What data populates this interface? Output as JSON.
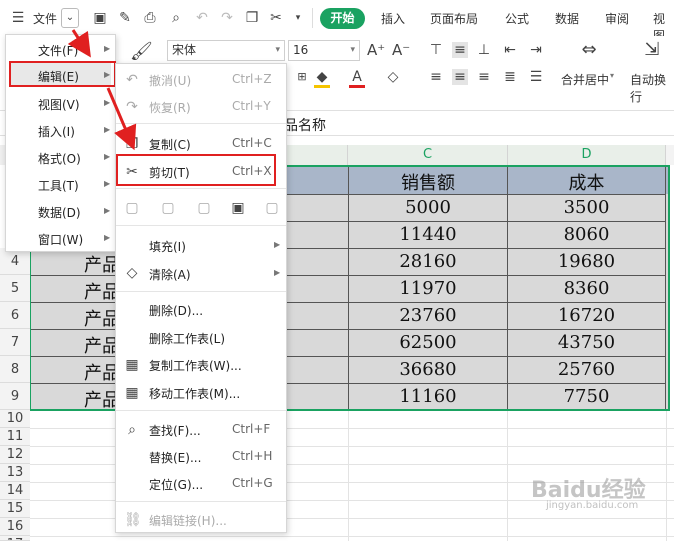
{
  "toolbar": {
    "menu_label": "文件",
    "tabs": [
      "开始",
      "插入",
      "页面布局",
      "公式",
      "数据",
      "审阅",
      "视图"
    ]
  },
  "ribbon": {
    "font_name": "宋体",
    "font_size": "16",
    "merge_label": "合并居中",
    "wrap_label": "自动换行"
  },
  "formula_bar": {
    "content": "品名称"
  },
  "columns": [
    "C",
    "D"
  ],
  "rows": [
    "4",
    "5",
    "6",
    "7",
    "8",
    "9",
    "10",
    "11",
    "12",
    "13",
    "14",
    "15",
    "16",
    "17",
    "18"
  ],
  "table": {
    "header": [
      "销售额",
      "成本"
    ],
    "partial_header": "t",
    "product_label": "产品",
    "sales": [
      "5000",
      "11440",
      "28160",
      "11970",
      "23760",
      "62500",
      "36680",
      "11160"
    ],
    "cost": [
      "3500",
      "8060",
      "19680",
      "8360",
      "16720",
      "43750",
      "25760",
      "7750"
    ]
  },
  "main_menu": {
    "items": [
      "文件(F)",
      "编辑(E)",
      "视图(V)",
      "插入(I)",
      "格式(O)",
      "工具(T)",
      "数据(D)",
      "窗口(W)"
    ]
  },
  "edit_menu": {
    "undo": {
      "label": "撤消(U)",
      "shortcut": "Ctrl+Z"
    },
    "redo": {
      "label": "恢复(R)",
      "shortcut": "Ctrl+Y"
    },
    "copy": {
      "label": "复制(C)",
      "shortcut": "Ctrl+C"
    },
    "cut": {
      "label": "剪切(T)",
      "shortcut": "Ctrl+X"
    },
    "fill": "填充(I)",
    "clear": "清除(A)",
    "delete": "删除(D)...",
    "delete_sheet": "删除工作表(L)",
    "copy_sheet": "复制工作表(W)...",
    "move_sheet": "移动工作表(M)...",
    "find": {
      "label": "查找(F)...",
      "shortcut": "Ctrl+F"
    },
    "replace": {
      "label": "替换(E)...",
      "shortcut": "Ctrl+H"
    },
    "goto": {
      "label": "定位(G)...",
      "shortcut": "Ctrl+G"
    },
    "edit_links": "编辑链接(H)..."
  },
  "watermark": "Baidu经验",
  "watermark_url": "jingyan.baidu.com",
  "colors": {
    "accent": "#1aa261",
    "highlight": "#e02020",
    "header_fill": "#a9b6c9",
    "data_fill": "#d9d9d9"
  }
}
